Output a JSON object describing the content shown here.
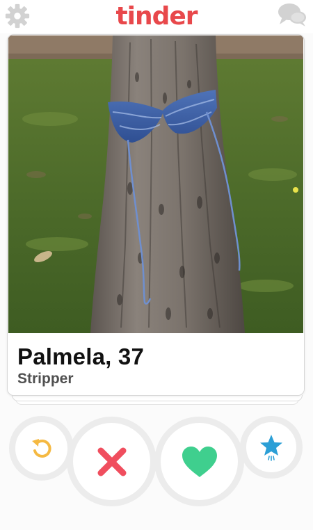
{
  "header": {
    "logo_text": "tinder",
    "logo_color": "#e8484b",
    "left_icon": "gear-icon",
    "right_icon": "chat-bubbles-icon"
  },
  "profile": {
    "name_age": "Palmela, 37",
    "job": "Stripper",
    "photo_description": "tree-trunk-wearing-bikini"
  },
  "actions": [
    {
      "name": "rewind",
      "icon": "rewind-icon",
      "color": "#f5b942"
    },
    {
      "name": "nope",
      "icon": "x-icon",
      "color": "#f04e5e"
    },
    {
      "name": "like",
      "icon": "heart-icon",
      "color": "#3fcf8e"
    },
    {
      "name": "super-like",
      "icon": "star-icon",
      "color": "#2b9fd6"
    }
  ],
  "colors": {
    "icon_gray": "#d2d2d2",
    "button_ring": "#ececec"
  }
}
